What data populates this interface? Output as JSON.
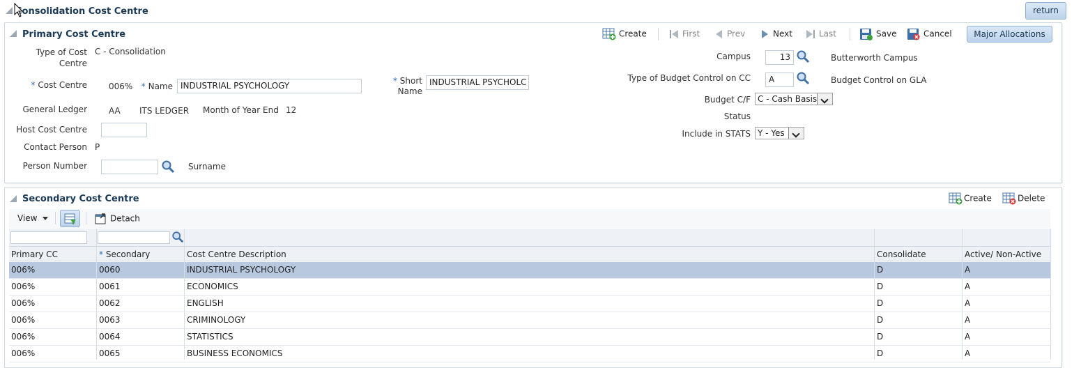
{
  "header": {
    "title": "Consolidation Cost Centre",
    "return_label": "return"
  },
  "primary": {
    "title": "Primary Cost Centre",
    "toolbar": {
      "create": "Create",
      "first": "First",
      "prev": "Prev",
      "next": "Next",
      "last": "Last",
      "save": "Save",
      "cancel": "Cancel",
      "major_allocations": "Major Allocations"
    },
    "type_of_cost_centre_label_1": "Type of Cost",
    "type_of_cost_centre_label_2": "Centre",
    "type_of_cost_centre_value": "C - Consolidation",
    "cost_centre_label": "Cost Centre",
    "cost_centre_value": "006%",
    "name_label": "Name",
    "name_value": "INDUSTRIAL PSYCHOLOGY",
    "short_name_label_1": "Short",
    "short_name_label_2": "Name",
    "short_name_value": "INDUSTRIAL PSYCHOLC",
    "general_ledger_label": "General Ledger",
    "general_ledger_code": "AA",
    "general_ledger_name": "ITS LEDGER",
    "month_year_end_label": "Month of Year End",
    "month_year_end_value": "12",
    "host_cost_centre_label": "Host Cost Centre",
    "host_cost_centre_value": "",
    "contact_person_label": "Contact Person",
    "contact_person_value": "P",
    "person_number_label": "Person Number",
    "person_number_value": "",
    "surname_label": "Surname",
    "campus_label": "Campus",
    "campus_value": "13",
    "campus_name": "Butterworth Campus",
    "budget_control_label": "Type of Budget Control on CC",
    "budget_control_value": "A",
    "budget_control_name": "Budget Control on GLA",
    "budget_cf_label": "Budget C/F",
    "budget_cf_value": "C - Cash Basis",
    "status_label": "Status",
    "include_stats_label": "Include in STATS",
    "include_stats_value": "Y - Yes"
  },
  "secondary": {
    "title": "Secondary Cost Centre",
    "create": "Create",
    "delete": "Delete",
    "view_label": "View",
    "detach_label": "Detach",
    "columns": {
      "primary_cc": "Primary CC",
      "secondary": "Secondary",
      "description": "Cost Centre Description",
      "consolidate": "Consolidate",
      "active": "Active/ Non-Active"
    },
    "rows": [
      {
        "primary": "006%",
        "secondary": "0060",
        "description": "INDUSTRIAL PSYCHOLOGY",
        "consolidate": "D",
        "active": "A"
      },
      {
        "primary": "006%",
        "secondary": "0061",
        "description": "ECONOMICS",
        "consolidate": "D",
        "active": "A"
      },
      {
        "primary": "006%",
        "secondary": "0062",
        "description": "ENGLISH",
        "consolidate": "D",
        "active": "A"
      },
      {
        "primary": "006%",
        "secondary": "0063",
        "description": "CRIMINOLOGY",
        "consolidate": "D",
        "active": "A"
      },
      {
        "primary": "006%",
        "secondary": "0064",
        "description": "STATISTICS",
        "consolidate": "D",
        "active": "A"
      },
      {
        "primary": "006%",
        "secondary": "0065",
        "description": "BUSINESS ECONOMICS",
        "consolidate": "D",
        "active": "A"
      }
    ]
  },
  "icons": {
    "search": "magnifier-icon",
    "create": "table-add-icon",
    "delete": "table-delete-icon",
    "save": "save-icon",
    "cancel": "cancel-icon",
    "detach": "detach-icon"
  }
}
